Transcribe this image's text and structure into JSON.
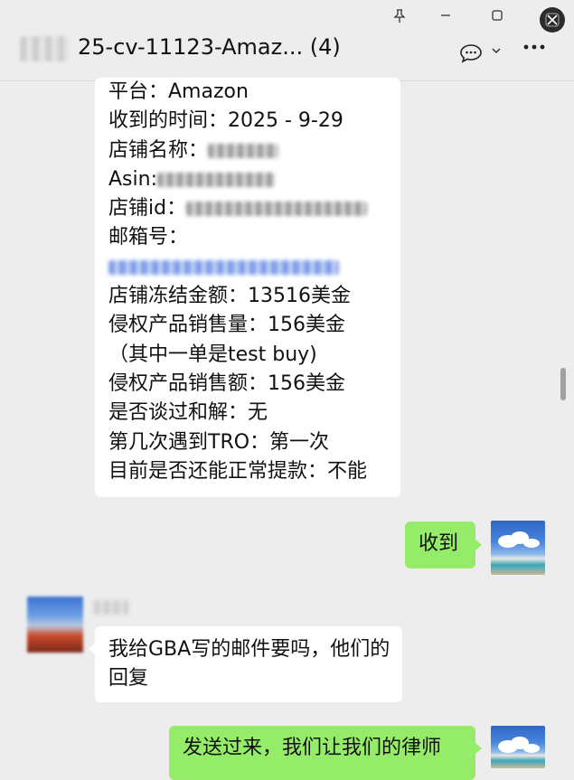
{
  "window": {
    "pin_icon": "pin-icon",
    "minimize_icon": "minimize-icon",
    "maximize_icon": "maximize-icon",
    "close_icon": "close-icon"
  },
  "header": {
    "title": "25-cv-11123-Amaz... (4)",
    "chat_icon": "chat-bubble-icon",
    "more_icon": "more-icon"
  },
  "messages": {
    "m1": {
      "platform": "平台：Amazon",
      "received_time": "收到的时间：2025 - 9-29",
      "store_name_label": "店铺名称：",
      "asin_label": "Asin:",
      "store_id_label": "店铺id：",
      "email_label": "邮箱号：",
      "frozen_amount": "店铺冻结金额：13516美金",
      "infringing_sales_qty": "侵权产品销售量：156美金",
      "test_buy_note": "（其中一单是test buy)",
      "infringing_sales_amount": "侵权产品销售额：156美金",
      "settlement": "是否谈过和解：无",
      "tro_count": "第几次遇到TRO：第一次",
      "withdraw": "目前是否还能正常提款：不能"
    },
    "m2": {
      "text": "收到"
    },
    "m3": {
      "text": "我给GBA写的邮件要吗，他们的回复"
    },
    "m4": {
      "text": "发送过来，我们让我们的律师"
    }
  },
  "colors": {
    "background": "#ededed",
    "bubble_self": "#95ec69",
    "bubble_other": "#ffffff"
  }
}
